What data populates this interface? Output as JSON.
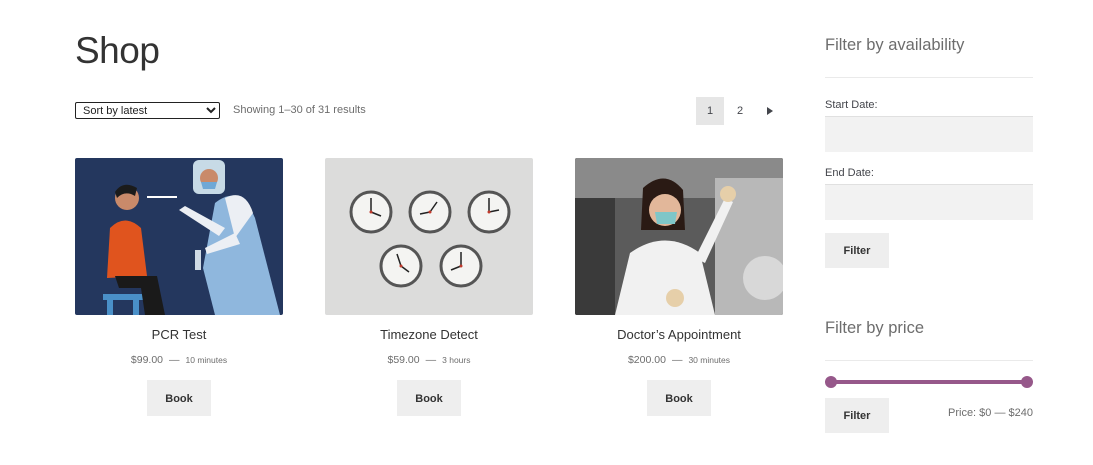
{
  "page": {
    "title": "Shop"
  },
  "toolbar": {
    "sort_selected": "Sort by latest",
    "result_count": "Showing 1–30 of 31 results"
  },
  "pagination": {
    "pages": [
      "1",
      "2"
    ],
    "current": "1",
    "next_icon": "triangle-right-icon"
  },
  "products": [
    {
      "name": "PCR Test",
      "price": "$99.00",
      "separator": "—",
      "duration": "10 minutes",
      "button": "Book"
    },
    {
      "name": "Timezone Detect",
      "price": "$59.00",
      "separator": "—",
      "duration": "3 hours",
      "button": "Book"
    },
    {
      "name": "Doctor’s Appointment",
      "price": "$200.00",
      "separator": "—",
      "duration": "30 minutes",
      "button": "Book"
    }
  ],
  "sidebar": {
    "availability": {
      "title": "Filter by availability",
      "start_label": "Start Date:",
      "end_label": "End Date:",
      "button": "Filter"
    },
    "price": {
      "title": "Filter by price",
      "button": "Filter",
      "label": "Price: $0 — $240",
      "min": 0,
      "max": 240,
      "accent": "#96588a"
    }
  }
}
